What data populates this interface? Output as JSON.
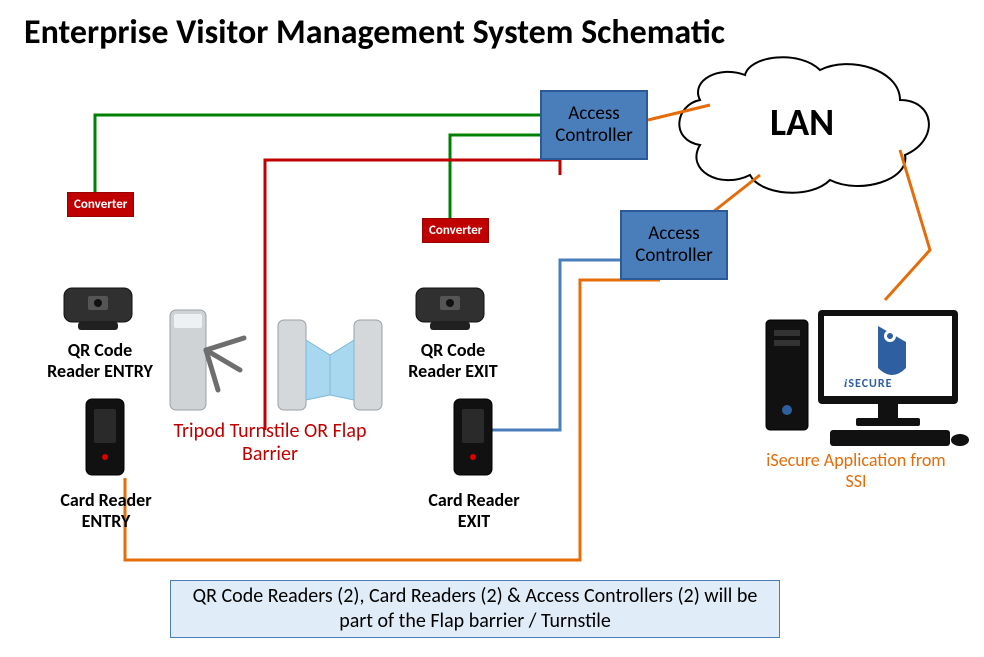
{
  "title": "Enterprise Visitor Management System Schematic",
  "access_controller_1": "Access Controller",
  "access_controller_2": "Access Controller",
  "converter_1": "Converter",
  "converter_2": "Converter",
  "lan": "LAN",
  "qr_entry": "QR Code Reader ENTRY",
  "qr_exit": "QR Code Reader EXIT",
  "card_entry": "Card Reader ENTRY",
  "card_exit": "Card Reader EXIT",
  "turnstile": "Tripod Turnstile OR Flap Barrier",
  "app": "iSecure Application from SSI",
  "isecure": "SECURE",
  "footer": "QR Code Readers (2),  Card Readers (2)  & Access Controllers (2) will be part of the Flap barrier / Turnstile"
}
